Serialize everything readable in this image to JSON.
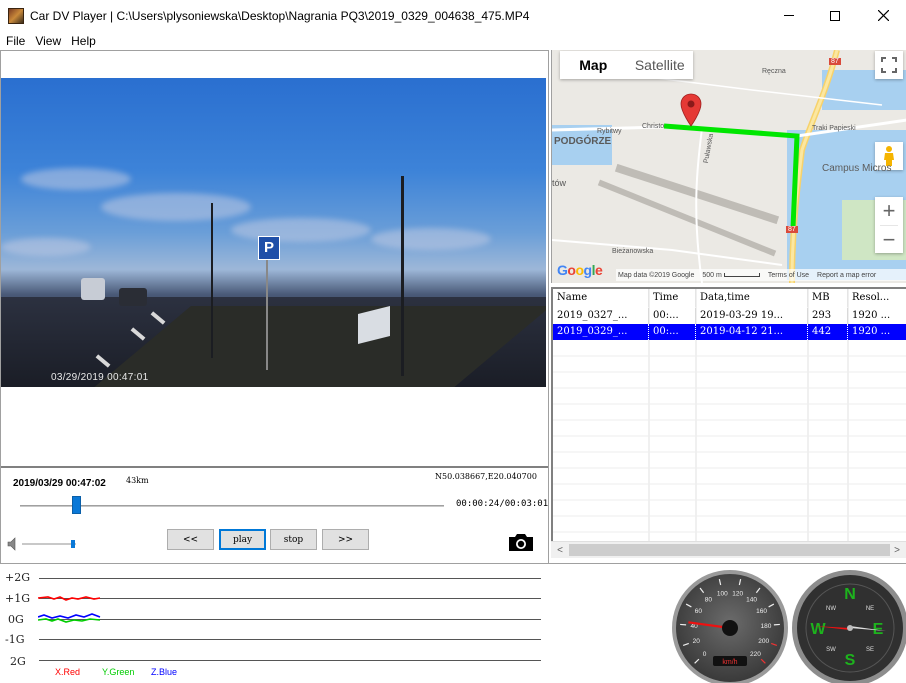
{
  "window": {
    "title": "Car DV Player | C:\\Users\\plysoniewska\\Desktop\\Nagrania PQ3\\2019_0329_004638_475.MP4",
    "icon": "app-icon"
  },
  "menu": [
    {
      "label": "File"
    },
    {
      "label": "View"
    },
    {
      "label": "Help"
    }
  ],
  "video": {
    "overlay_timestamp": "03/29/2019  00:47:01",
    "sign_letter": "P"
  },
  "player": {
    "datetime": "2019/03/29 00:47:02",
    "speed": "43km",
    "gps": "N50.038667,E20.040700",
    "time": "00:00:24/00:03:01",
    "progress": 0.133,
    "volume": 0.95,
    "buttons": {
      "rewind": "<<",
      "play": "play",
      "stop": "stop",
      "forward": ">>"
    }
  },
  "map": {
    "tabs": [
      {
        "label": "Map",
        "selected": true
      },
      {
        "label": "Satellite",
        "selected": false
      }
    ],
    "labels": {
      "podgorze": "PODGÓRZE",
      "campus": "Campus Micros",
      "reczna": "Ręczna",
      "christo": "Christo",
      "rybitwy": "Rybitwy",
      "traki": "Traki Papieski",
      "pulawska": "Puławska",
      "bizanowska": "Bieżanowska",
      "tow": "tów",
      "road_a": "7",
      "road_b": "87"
    },
    "footer": {
      "google": "Google",
      "map_data": "Map data ©2019 Google",
      "scale": "500 m",
      "terms": "Terms of Use",
      "report": "Report a map error"
    },
    "route_color": "#00e600",
    "pin_color": "#e53935"
  },
  "file_list": {
    "columns": [
      "Name",
      "Time",
      "Data,time",
      "MB",
      "Resol..."
    ],
    "rows": [
      {
        "name": "2019_0327_...",
        "time": "00:...",
        "datetime": "2019-03-29 19...",
        "mb": "293",
        "resolution": "1920 ...",
        "selected": false
      },
      {
        "name": "2019_0329_...",
        "time": "00:...",
        "datetime": "2019-04-12 21...",
        "mb": "442",
        "resolution": "1920 ...",
        "selected": true
      }
    ]
  },
  "gsensor": {
    "labels": [
      "+2G",
      "+1G",
      "0G",
      "-1G",
      "2G"
    ],
    "legend": [
      {
        "label": "X.Red",
        "color": "#ff0000"
      },
      {
        "label": "Y.Green",
        "color": "#00cc00"
      },
      {
        "label": "Z.Blue",
        "color": "#0000ff"
      }
    ]
  },
  "speedometer": {
    "ticks": [
      "0",
      "20",
      "40",
      "60",
      "80",
      "100",
      "120",
      "140",
      "160",
      "180",
      "200",
      "220"
    ],
    "unit": "km/h",
    "value": 43
  },
  "compass": {
    "labels": {
      "n": "N",
      "e": "E",
      "s": "S",
      "w": "W",
      "ne": "NE",
      "nw": "NW",
      "se": "SE",
      "sw": "SW"
    }
  }
}
